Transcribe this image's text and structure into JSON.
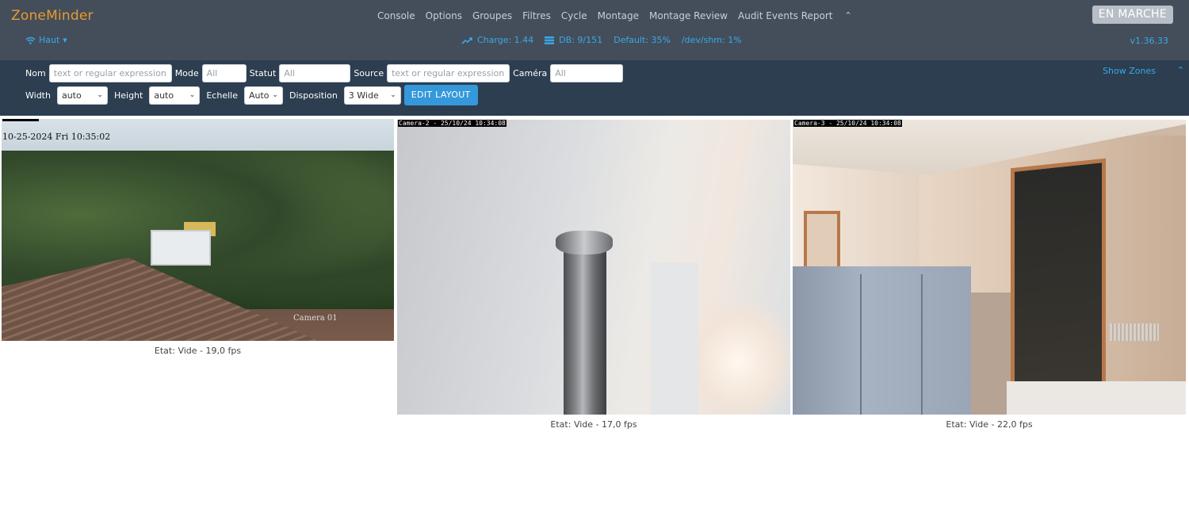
{
  "brand": "ZoneMinder",
  "menu": [
    "Console",
    "Options",
    "Groupes",
    "Filtres",
    "Cycle",
    "Montage",
    "Montage Review",
    "Audit Events Report"
  ],
  "status_button": "EN MARCHE",
  "bandwidth": "Haut",
  "stats": {
    "load": "Charge: 1.44",
    "db": "DB: 9/151",
    "default_storage": "Default: 35%",
    "shm": "/dev/shm: 1%"
  },
  "version": "v1.36.33",
  "filters": {
    "name_label": "Nom",
    "name_placeholder": "text or regular expression",
    "mode_label": "Mode",
    "mode_value": "All",
    "status_label": "Statut",
    "status_value": "All",
    "source_label": "Source",
    "source_placeholder": "text or regular expression",
    "camera_label": "Caméra",
    "camera_value": "All",
    "show_zones": "Show Zones"
  },
  "layout": {
    "width_label": "Width",
    "width_value": "auto",
    "height_label": "Height",
    "height_value": "auto",
    "scale_label": "Echelle",
    "scale_value": "Auto",
    "layout_label": "Disposition",
    "layout_value": "3 Wide",
    "edit_button": "EDIT LAYOUT"
  },
  "monitors": [
    {
      "timestamp": "10-25-2024 Fri 10:35:02",
      "cam_label": "Camera 01",
      "caption": "Etat: Vide - 19,0 fps"
    },
    {
      "osd": "Camera-2 - 25/10/24 10:34:08",
      "caption": "Etat: Vide - 17,0 fps"
    },
    {
      "osd": "Camera-3 - 25/10/24 10:34:08",
      "caption": "Etat: Vide - 22,0 fps"
    }
  ]
}
